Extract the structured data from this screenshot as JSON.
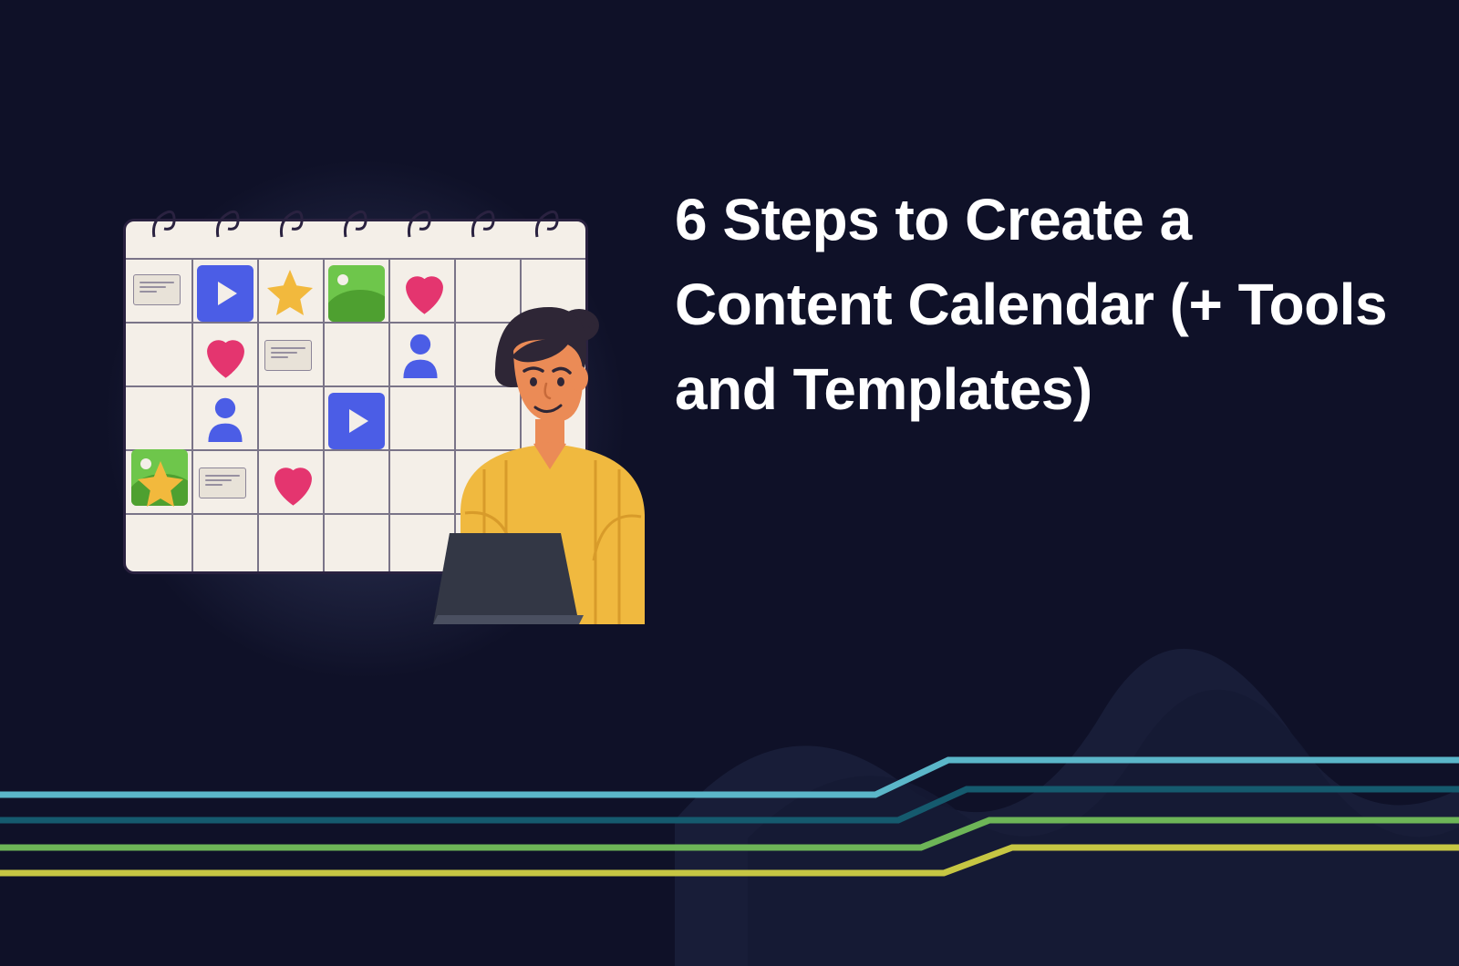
{
  "title": "6 Steps to Create a Content Calendar (+ Tools and Templates)",
  "colors": {
    "bg": "#0f1128",
    "text": "#ffffff",
    "line1": "#5bb6c9",
    "line2": "#155a6e",
    "line3": "#6db557",
    "line4": "#c6c643",
    "blue": "#4b5de6",
    "green": "#6ec64b",
    "pink": "#e4356f",
    "starYellow": "#f2b93d",
    "skin": "#eb8b56",
    "shirt": "#f0b93f",
    "hair": "#2e2636",
    "laptop": "#333745"
  },
  "illustration": {
    "kind": "content-calendar-with-person",
    "calendar_grid": {
      "cols": 7,
      "rows": 5
    },
    "icons": [
      "play",
      "star",
      "image",
      "heart",
      "user",
      "note"
    ]
  }
}
